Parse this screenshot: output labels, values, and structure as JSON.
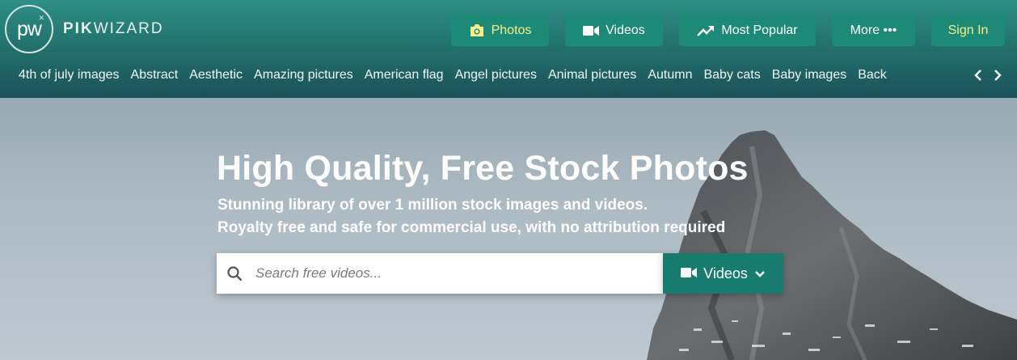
{
  "logo": {
    "mark": "pw",
    "name_bold": "PIK",
    "name_rest": "WIZARD"
  },
  "nav": {
    "photos": "Photos",
    "videos": "Videos",
    "most_popular": "Most Popular",
    "more": "More •••",
    "signin": "Sign In"
  },
  "categories": [
    "4th of july images",
    "Abstract",
    "Aesthetic",
    "Amazing pictures",
    "American flag",
    "Angel pictures",
    "Animal pictures",
    "Autumn",
    "Baby cats",
    "Baby images",
    "Back"
  ],
  "hero": {
    "title": "High Quality, Free Stock Photos",
    "subtitle_1": "Stunning library of over 1 million stock images and videos.",
    "subtitle_2": "Royalty free and safe for commercial use, with no attribution required"
  },
  "search": {
    "placeholder": "Search free videos...",
    "type_label": "Videos"
  },
  "colors": {
    "accent": "#1d8a77",
    "highlight": "#f6f08a",
    "header_top": "#2c8f86",
    "header_bottom": "#1a5159"
  },
  "icons": [
    "camera-icon",
    "video-camera-icon",
    "trending-icon",
    "chevron-left-icon",
    "chevron-right-icon",
    "search-icon",
    "chevron-down-icon"
  ]
}
